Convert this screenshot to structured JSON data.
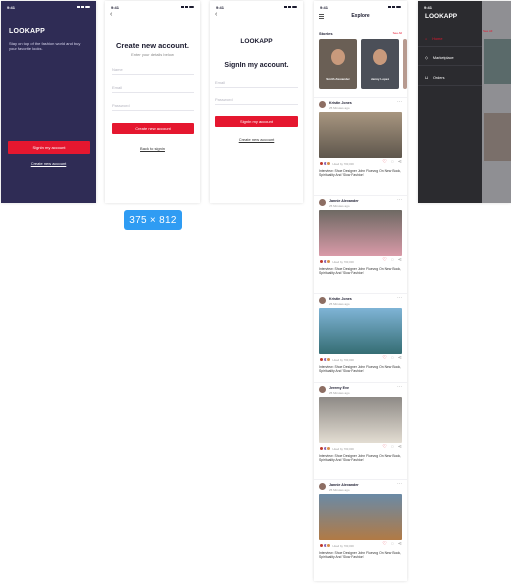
{
  "status_time": "9:41",
  "dimension_badge": "375 × 812",
  "splash": {
    "brand": "LOOKAPP",
    "tagline": "Stay on top of the fashion world and buy your favorite looks.",
    "signin_button": "SignIn my account",
    "create_link": "Create new account"
  },
  "create": {
    "back": "‹",
    "title": "Create new account.",
    "subtitle": "Enter your details below",
    "fields": [
      "Name",
      "Email",
      "Password"
    ],
    "button": "Create new account",
    "link": "Back to signin"
  },
  "signin": {
    "back": "‹",
    "brand": "LOOKAPP",
    "title": "SignIn my account.",
    "fields": [
      "Email",
      "Password"
    ],
    "button": "SignIn my account",
    "link": "Create new account"
  },
  "explore": {
    "title": "Explore",
    "stories_heading": "Stories",
    "see_all": "See All",
    "stories": [
      {
        "name": "Smith Alexander",
        "bg": "#6a5f55"
      },
      {
        "name": "Jenny Lopez",
        "bg": "#4b4f58"
      }
    ],
    "liked_text": "Liked by 700,000",
    "caption": "Interview: Shoe Designer John Fluevog On New Book, Spirituality And 'Slow Fashion'",
    "posts": [
      {
        "author": "Kristin Jones",
        "time": "25 Minutes ago",
        "img_top": "#a89680",
        "img_bottom": "#5e564c"
      },
      {
        "author": "Jannie Alexander",
        "time": "25 Minutes ago",
        "img_top": "#6e6963",
        "img_bottom": "#d99aa8"
      },
      {
        "author": "Kristin Jones",
        "time": "25 Minutes ago",
        "img_top": "#7fb4d6",
        "img_bottom": "#356d73"
      },
      {
        "author": "Jeremy Eve",
        "time": "25 Minutes ago",
        "img_top": "#8e8a86",
        "img_bottom": "#e3ddd2"
      },
      {
        "author": "Jannie Alexander",
        "time": "25 Minutes ago",
        "img_top": "#6a8aa6",
        "img_bottom": "#b17a45"
      }
    ]
  },
  "menu": {
    "brand": "LOOKAPP",
    "items": [
      {
        "label": "Home",
        "active": true
      },
      {
        "label": "Marketplace",
        "active": false
      },
      {
        "label": "Orders",
        "active": false
      }
    ],
    "peek_text": "See All"
  },
  "colors": {
    "brand_red": "#e5172f",
    "splash_bg": "#2f2c55",
    "drawer_bg": "#2b2b2f",
    "badge_blue": "#2f9cf3"
  }
}
